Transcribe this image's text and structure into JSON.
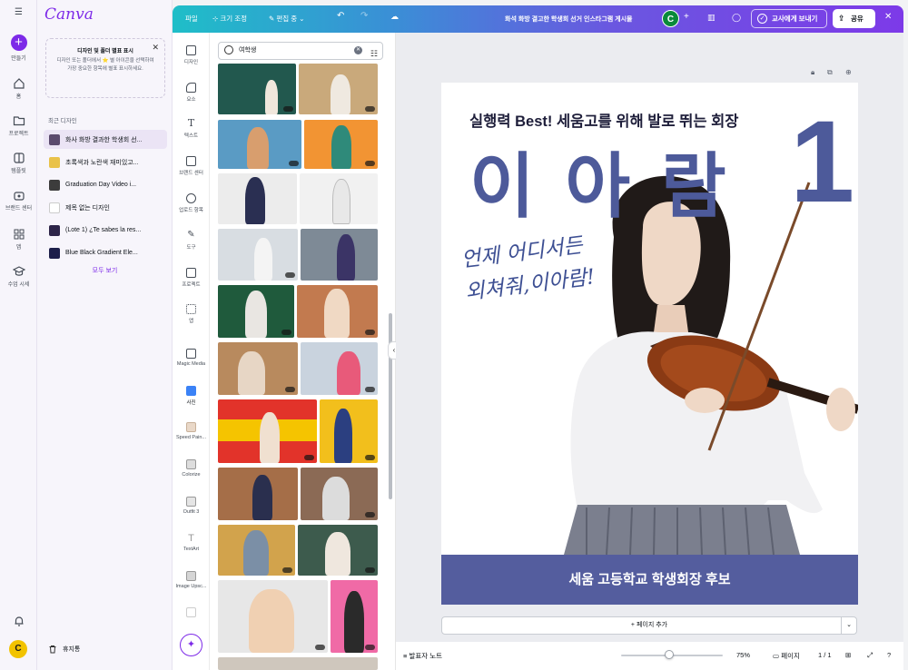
{
  "rail": {
    "create": "만들기",
    "home": "홈",
    "projects": "프로젝트",
    "templates": "템플릿",
    "brand": "브랜드 센터",
    "apps": "앱",
    "classes": "수업 시세",
    "avatar": "C"
  },
  "sidepanel": {
    "logo": "Canva",
    "tip_title": "디자인 및 폴더 별표 표시",
    "tip_body": "디자인 또는 폴더에서 ⭐ 별 아이콘을 선택하여 가장 중요한 항목에 별표 표시하세요.",
    "recent_label": "최근 디자인",
    "recent": [
      {
        "label": "화사 화방 결과한 학생회 선..."
      },
      {
        "label": "초록색과 노란색 재미있고..."
      },
      {
        "label": "Graduation Day Video i..."
      },
      {
        "label": "제목 없는 디자인"
      },
      {
        "label": "(Lote 1) ¿Te sabes la res..."
      },
      {
        "label": "Blue Black Gradient Ele..."
      }
    ],
    "see_all": "모두 보기",
    "trash": "휴지통"
  },
  "topbar": {
    "file": "파일",
    "resize": "크기 조정",
    "edit": "편집 중",
    "title": "화석 화방 결고한 학생회 선거 인스타그램 게시물",
    "avatar": "C",
    "send_teacher": "교사에게 보내기",
    "share": "공유"
  },
  "tools": [
    {
      "label": "디자인"
    },
    {
      "label": "요소"
    },
    {
      "label": "텍스트"
    },
    {
      "label": "브랜드 센터"
    },
    {
      "label": "업로드 항목"
    },
    {
      "label": "도구"
    },
    {
      "label": "프로젝트"
    },
    {
      "label": "앱"
    },
    {
      "label": "Magic Media"
    },
    {
      "label": "사진"
    },
    {
      "label": "Speed Pain..."
    },
    {
      "label": "Colorize"
    },
    {
      "label": "Outfit 3"
    },
    {
      "label": "TextArt"
    },
    {
      "label": "Image Upsc..."
    }
  ],
  "search": {
    "value": "여학생"
  },
  "design": {
    "headline": "실행력 Best! 세움고를 위해 발로 뛰는 회장",
    "name": "이 아 람",
    "number": "1",
    "slogan_line1": "언제 어디서든",
    "slogan_line2": "외쳐줘,이아람!",
    "banner": "세움 고등학교 학생회장 후보",
    "accent_color": "#4d5a9a",
    "banner_color": "#545d9e"
  },
  "canvas": {
    "add_page": "+ 페이지 추가"
  },
  "bottombar": {
    "notes": "발표자 노트",
    "zoom": "75%",
    "zoom_fraction": 0.47,
    "pages": "페이지",
    "page_count": "1 / 1"
  }
}
